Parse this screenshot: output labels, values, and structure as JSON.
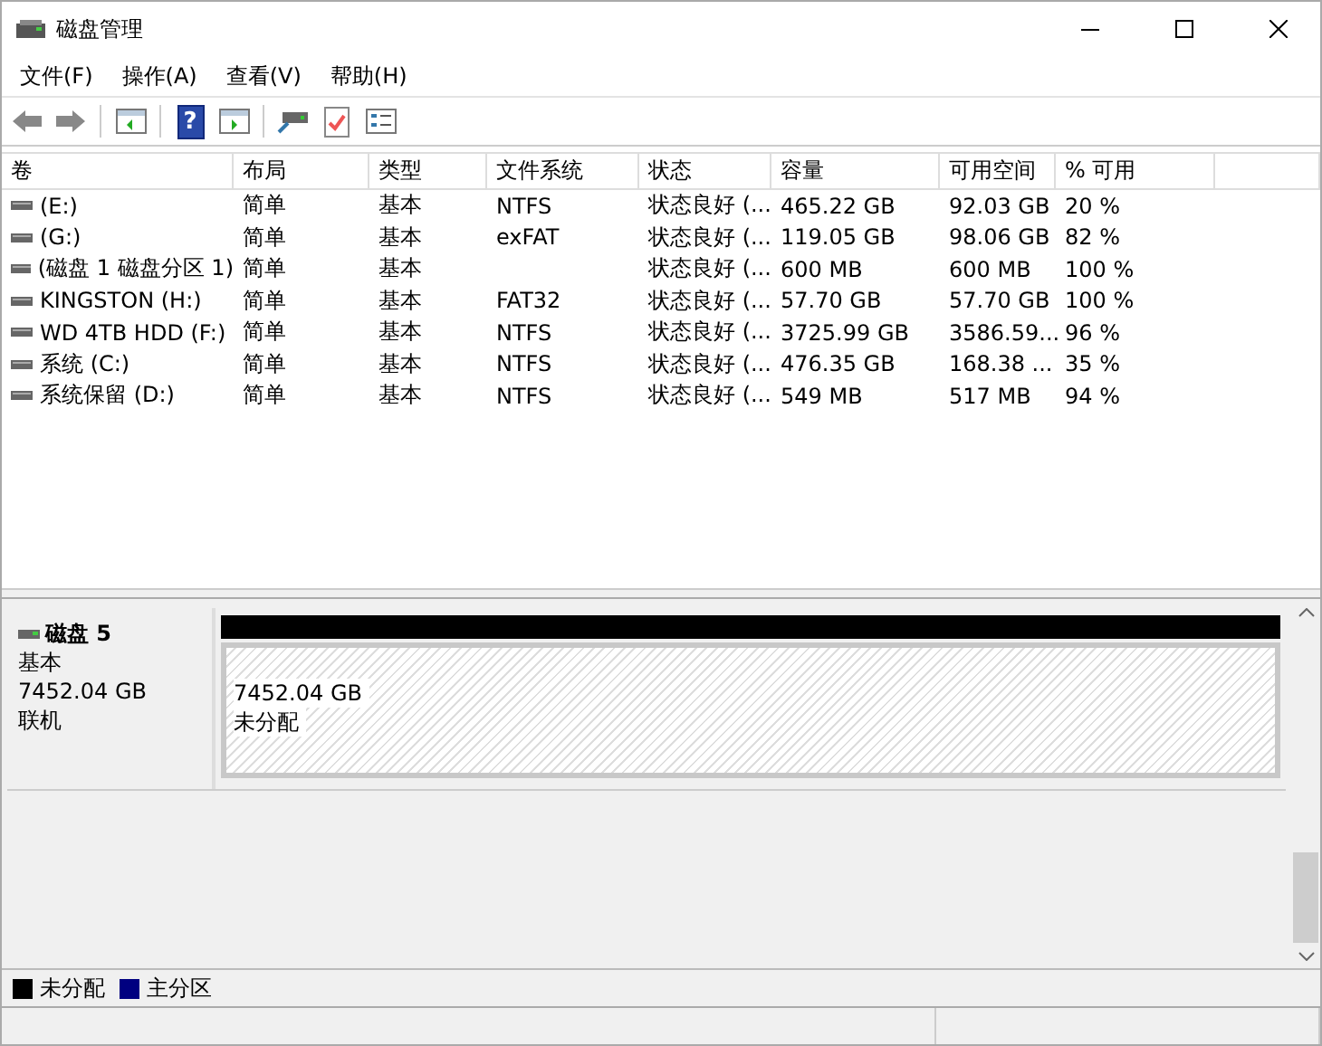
{
  "window": {
    "title": "磁盘管理"
  },
  "menu": [
    "文件(F)",
    "操作(A)",
    "查看(V)",
    "帮助(H)"
  ],
  "toolbar": [
    {
      "kind": "back",
      "disabled": true
    },
    {
      "kind": "forward",
      "disabled": true
    },
    {
      "kind": "sep"
    },
    {
      "kind": "tree"
    },
    {
      "kind": "sep"
    },
    {
      "kind": "help",
      "glyph": "?"
    },
    {
      "kind": "pane"
    },
    {
      "kind": "sep"
    },
    {
      "kind": "drive"
    },
    {
      "kind": "check"
    },
    {
      "kind": "list"
    }
  ],
  "table": {
    "columns": [
      "卷",
      "布局",
      "类型",
      "文件系统",
      "状态",
      "容量",
      "可用空间",
      "% 可用"
    ],
    "rows": [
      [
        "(E:)",
        "简单",
        "基本",
        "NTFS",
        "状态良好 (...",
        "465.22 GB",
        "92.03 GB",
        "20 %"
      ],
      [
        "(G:)",
        "简单",
        "基本",
        "exFAT",
        "状态良好 (...",
        "119.05 GB",
        "98.06 GB",
        "82 %"
      ],
      [
        "(磁盘 1 磁盘分区 1)",
        "简单",
        "基本",
        "",
        "状态良好 (...",
        "600 MB",
        "600 MB",
        "100 %"
      ],
      [
        "KINGSTON (H:)",
        "简单",
        "基本",
        "FAT32",
        "状态良好 (...",
        "57.70 GB",
        "57.70 GB",
        "100 %"
      ],
      [
        "WD 4TB HDD (F:)",
        "简单",
        "基本",
        "NTFS",
        "状态良好 (...",
        "3725.99 GB",
        "3586.59...",
        "96 %"
      ],
      [
        "系统 (C:)",
        "简单",
        "基本",
        "NTFS",
        "状态良好 (...",
        "476.35 GB",
        "168.38 ...",
        "35 %"
      ],
      [
        "系统保留 (D:)",
        "简单",
        "基本",
        "NTFS",
        "状态良好 (...",
        "549 MB",
        "517 MB",
        "94 %"
      ]
    ]
  },
  "disks": [
    {
      "name": "磁盘 5",
      "type": "基本",
      "size": "7452.04 GB",
      "status": "联机",
      "partitions": [
        {
          "size": "7452.04 GB",
          "status": "未分配",
          "color": "#000000"
        }
      ]
    }
  ],
  "legend": [
    {
      "label": "未分配",
      "color": "#000000"
    },
    {
      "label": "主分区",
      "color": "#000080"
    }
  ]
}
